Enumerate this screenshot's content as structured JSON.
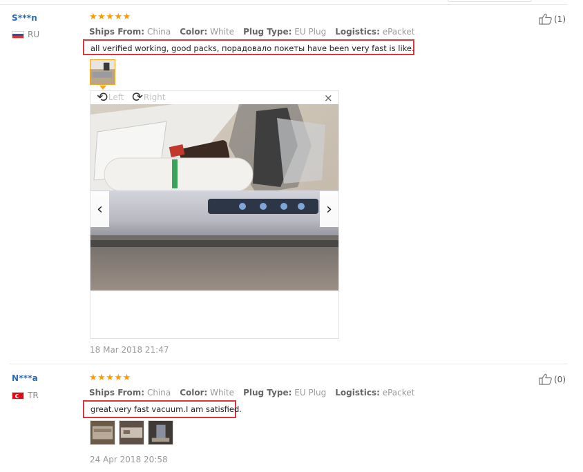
{
  "reviews": [
    {
      "username": "S***n",
      "country": "RU",
      "stars": "★★★★★",
      "attrs": [
        {
          "key": "Ships From:",
          "value": "China"
        },
        {
          "key": "Color:",
          "value": "White"
        },
        {
          "key": "Plug Type:",
          "value": "EU Plug"
        },
        {
          "key": "Logistics:",
          "value": "ePacket"
        }
      ],
      "text": "all verified working, good packs, порадовало покеты have been very fast is like.",
      "date": "18 Mar 2018 21:47",
      "helpful_count": "(1)"
    },
    {
      "username": "N***a",
      "country": "TR",
      "stars": "★★★★★",
      "attrs": [
        {
          "key": "Ships From:",
          "value": "China"
        },
        {
          "key": "Color:",
          "value": "White"
        },
        {
          "key": "Plug Type:",
          "value": "EU Plug"
        },
        {
          "key": "Logistics:",
          "value": "ePacket"
        }
      ],
      "text": "great.very fast vacuum.I am satisfied.",
      "date": "24 Apr 2018 20:58",
      "helpful_count": "(0)"
    }
  ],
  "viewer": {
    "rotate_left": "Left",
    "rotate_right": "Right",
    "close": "×",
    "prev": "‹",
    "next": "›"
  },
  "icons": {
    "thumbs_up": "thumbs-up-icon",
    "rotate_left": "rotate-left-icon",
    "rotate_right": "rotate-right-icon"
  },
  "colors": {
    "username": "#2a6bb4",
    "star": "#ff9b00",
    "highlight_border": "#d9363e"
  }
}
